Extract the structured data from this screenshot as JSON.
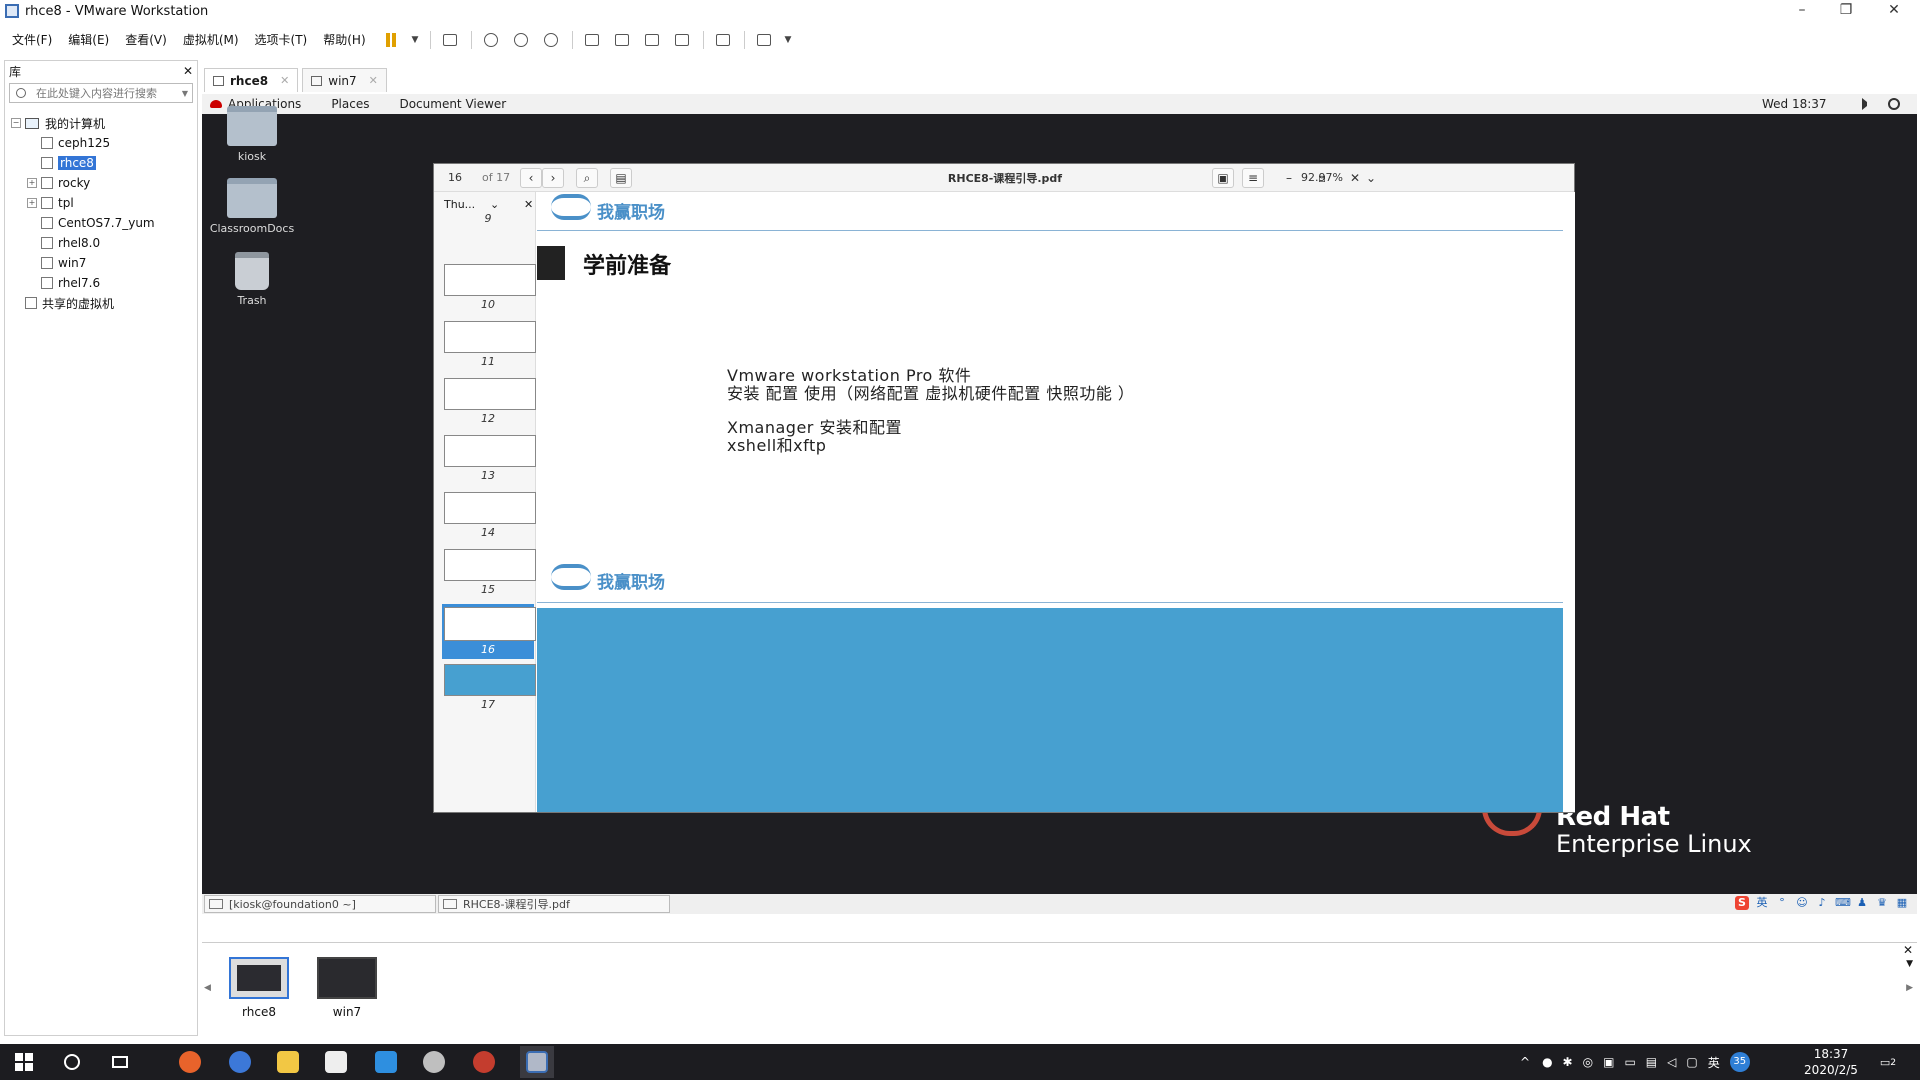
{
  "window": {
    "title": "rhce8 - VMware Workstation"
  },
  "menubar": [
    "文件(F)",
    "编辑(E)",
    "查看(V)",
    "虚拟机(M)",
    "选项卡(T)",
    "帮助(H)"
  ],
  "library": {
    "title": "库",
    "search_placeholder": "在此处键入内容进行搜索",
    "tree": [
      {
        "label": "我的计算机",
        "level": 0,
        "type": "computer",
        "expander": "−"
      },
      {
        "label": "ceph125",
        "level": 1,
        "type": "vm"
      },
      {
        "label": "rhce8",
        "level": 1,
        "type": "vm",
        "selected": true
      },
      {
        "label": "rocky",
        "level": 1,
        "type": "vm",
        "expander": "+"
      },
      {
        "label": "tpl",
        "level": 1,
        "type": "vm",
        "expander": "+"
      },
      {
        "label": "CentOS7.7_yum",
        "level": 1,
        "type": "vm"
      },
      {
        "label": "rhel8.0",
        "level": 1,
        "type": "vm"
      },
      {
        "label": "win7",
        "level": 1,
        "type": "vm"
      },
      {
        "label": "rhel7.6",
        "level": 1,
        "type": "vm"
      },
      {
        "label": "共享的虚拟机",
        "level": 0,
        "type": "shared"
      }
    ]
  },
  "vm_tabs": [
    {
      "label": "rhce8",
      "active": true
    },
    {
      "label": "win7",
      "active": false
    }
  ],
  "gnome": {
    "menus": [
      "Applications",
      "Places",
      "Document Viewer"
    ],
    "clock": "Wed 18:37",
    "desktop_icons": [
      "kiosk",
      "ClassroomDocs",
      "Trash"
    ],
    "taskbar": [
      "[kiosk@foundation0 ~]",
      "RHCE8-课程引导.pdf"
    ],
    "ime_lang": "英"
  },
  "rhel_logo": {
    "line1": "Red Hat",
    "line2": "Enterprise Linux"
  },
  "viewer": {
    "page": "16",
    "of": "of 17",
    "filename": "RHCE8-课程引导.pdf",
    "zoom": "92.97%",
    "sidebar_mode": "Thu...",
    "thumbnails": [
      "9",
      "10",
      "11",
      "12",
      "13",
      "14",
      "15",
      "16",
      "17"
    ],
    "active_thumbnail": "16"
  },
  "slide": {
    "brand": "我赢职场",
    "heading": "学前准备",
    "lines": [
      "Vmware workstation Pro 软件",
      "安装 配置 使用（网络配置 虚拟机硬件配置 快照功能 ）",
      "Xmanager 安装和配置",
      "xshell和xftp"
    ],
    "accent": "#47a0d0"
  },
  "thumbbar": {
    "items": [
      "rhce8",
      "win7"
    ]
  },
  "win_taskbar": {
    "ime": "英",
    "time": "18:37",
    "date": "2020/2/5",
    "notifications": "2",
    "badge": "35"
  }
}
